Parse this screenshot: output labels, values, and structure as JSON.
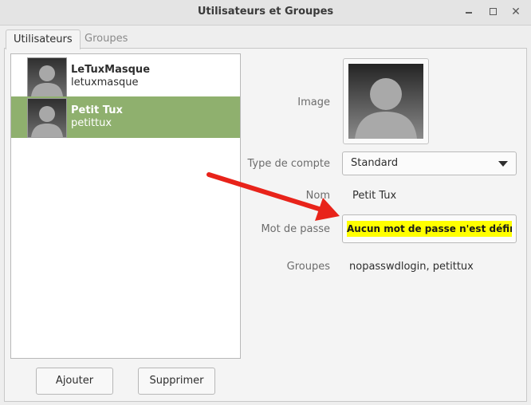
{
  "window": {
    "title": "Utilisateurs et Groupes",
    "icons": [
      "minimize-icon",
      "maximize-icon",
      "close-icon"
    ]
  },
  "tabs": [
    {
      "label": "Utilisateurs",
      "active": true
    },
    {
      "label": "Groupes",
      "active": false
    }
  ],
  "users": [
    {
      "name": "LeTuxMasque",
      "login": "letuxmasque",
      "selected": false
    },
    {
      "name": "Petit Tux",
      "login": "petittux",
      "selected": true
    }
  ],
  "buttons": {
    "add": "Ajouter",
    "remove": "Supprimer"
  },
  "details": {
    "image_label": "Image",
    "account_type_label": "Type de compte",
    "account_type_value": "Standard",
    "name_label": "Nom",
    "name_value": "Petit Tux",
    "password_label": "Mot de passe",
    "password_value": "Aucun mot de passe n'est défini",
    "groups_label": "Groupes",
    "groups_value": "nopasswdlogin, petittux"
  },
  "colors": {
    "selection": "#8fb06e",
    "highlight": "#ffff00",
    "annotation_arrow": "#e8231a"
  }
}
